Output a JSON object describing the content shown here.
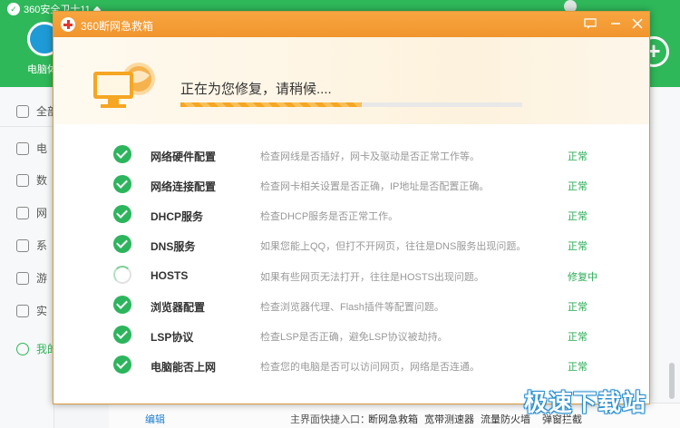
{
  "background_app": {
    "title": "360安全卫士11 ◆",
    "tile_label": "电脑体",
    "plus_glyph": "+",
    "sidebar": {
      "all_label": "全部",
      "items": [
        {
          "label": "电",
          "icon": "monitor-icon"
        },
        {
          "label": "数",
          "icon": "shield-icon"
        },
        {
          "label": "网",
          "icon": "globe-icon"
        },
        {
          "label": "系",
          "icon": "gear-icon"
        },
        {
          "label": "游",
          "icon": "gamepad-icon"
        },
        {
          "label": "实",
          "icon": "tool-icon"
        }
      ],
      "favorite_label": "我的"
    },
    "bottom_bar": {
      "edit_label": "编辑",
      "quick_entry_label": "主界面快捷入口：",
      "links": [
        "断网急救箱",
        "宽带测速器",
        "流量防火墙",
        "弹窗拦截"
      ]
    }
  },
  "dialog": {
    "title": "360断网急救箱",
    "status_text": "正在为您修复，请稍候....",
    "progress_percent": 53,
    "checks": [
      {
        "name": "网络硬件配置",
        "desc": "检查网线是否插好，网卡及驱动是否正常工作等。",
        "status": "正常",
        "state": "done"
      },
      {
        "name": "网络连接配置",
        "desc": "检查网卡相关设置是否正确，IP地址是否配置正确。",
        "status": "正常",
        "state": "done"
      },
      {
        "name": "DHCP服务",
        "desc": "检查DHCP服务是否正常工作。",
        "status": "正常",
        "state": "done"
      },
      {
        "name": "DNS服务",
        "desc": "如果您能上QQ，但打不开网页，往往是DNS服务出现问题。",
        "status": "正常",
        "state": "done"
      },
      {
        "name": "HOSTS",
        "desc": "如果有些网页无法打开，往往是HOSTS出现问题。",
        "status": "修复中",
        "state": "repairing"
      },
      {
        "name": "浏览器配置",
        "desc": "检查浏览器代理、Flash插件等配置问题。",
        "status": "正常",
        "state": "done"
      },
      {
        "name": "LSP协议",
        "desc": "检查LSP是否正确，避免LSP协议被劫持。",
        "status": "正常",
        "state": "done"
      },
      {
        "name": "电脑能否上网",
        "desc": "检查您的电脑是否可以访问网页，网络是否连通。",
        "status": "正常",
        "state": "done"
      }
    ]
  },
  "watermark": "极速下载站",
  "colors": {
    "green": "#2fb85a",
    "orange": "#f1952d",
    "ok": "#2bab55"
  }
}
